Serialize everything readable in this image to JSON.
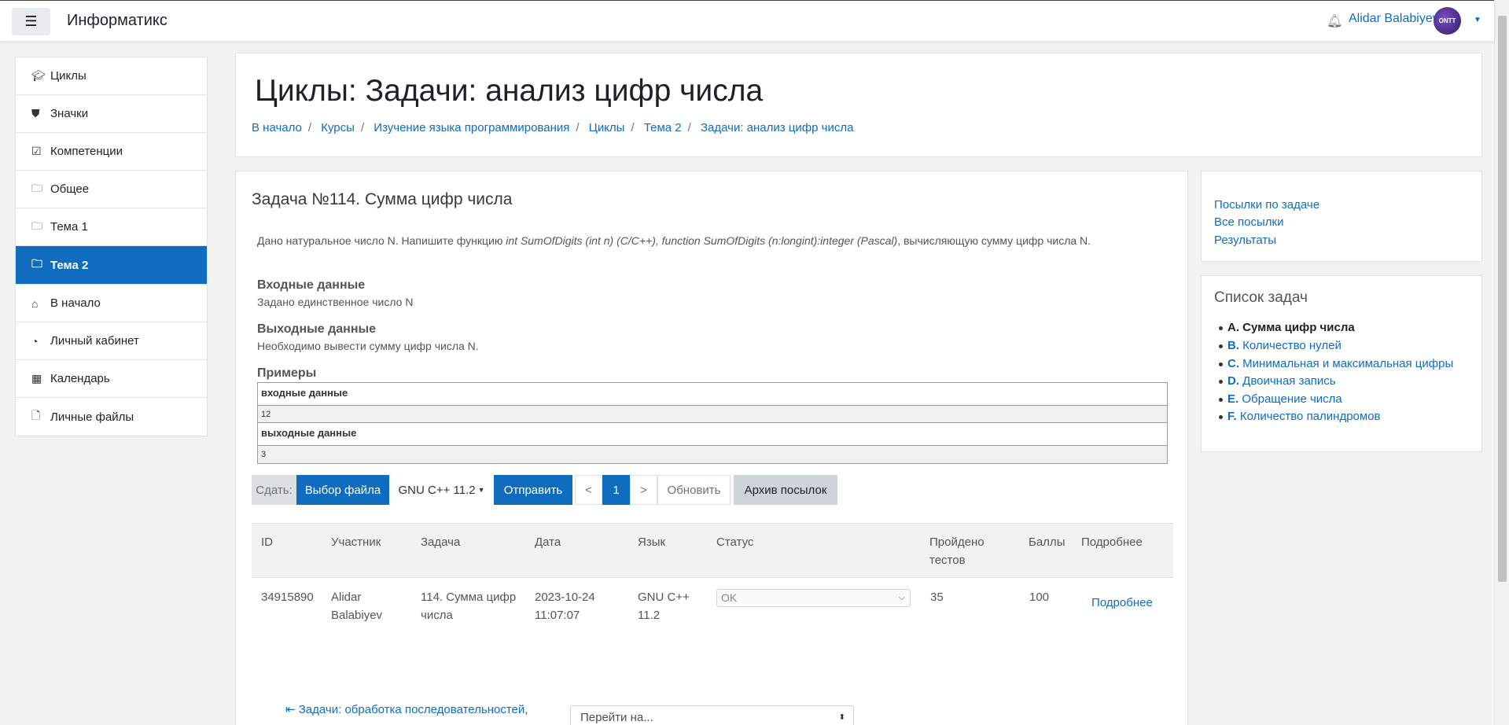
{
  "header": {
    "brand": "Информатикс",
    "user_name": "Alidar Balabiyev",
    "avatar_text": "ONTT"
  },
  "sidebar": {
    "course_items": [
      {
        "icon": "graduation-cap-icon",
        "glyph": "🎓",
        "label": "Циклы"
      },
      {
        "icon": "shield-icon",
        "glyph": "⛊",
        "label": "Значки"
      },
      {
        "icon": "check-square-icon",
        "glyph": "☑",
        "label": "Компетенции"
      },
      {
        "icon": "folder-icon",
        "glyph": "🗀",
        "label": "Общее"
      },
      {
        "icon": "folder-icon",
        "glyph": "🗀",
        "label": "Тема 1"
      },
      {
        "icon": "folder-icon",
        "glyph": "🗀",
        "label": "Тема 2",
        "active": true
      }
    ],
    "site_items": [
      {
        "icon": "home-icon",
        "glyph": "⌂",
        "label": "В начало"
      },
      {
        "icon": "dashboard-icon",
        "glyph": "◔",
        "label": "Личный кабинет"
      },
      {
        "icon": "calendar-icon",
        "glyph": "▦",
        "label": "Календарь"
      },
      {
        "icon": "file-icon",
        "glyph": "🗋",
        "label": "Личные файлы"
      }
    ]
  },
  "page": {
    "title": "Циклы: Задачи: анализ цифр числа",
    "breadcrumbs": [
      "В начало",
      "Курсы",
      "Изучение языка программирования",
      "Циклы",
      "Тема 2",
      "Задачи: анализ цифр числа"
    ]
  },
  "problem": {
    "heading": "Задача №114. Сумма цифр числа",
    "desc_pre": "Дано натуральное число N. Напишите функцию ",
    "desc_code1": "int SumOfDigits (int n) (C/C++), function SumOfDigits (n:longint):integer (Pascal)",
    "desc_post": ", вычисляющую сумму цифр числа N.",
    "input_h": "Входные данные",
    "input_t": "Задано единственное число N",
    "output_h": "Выходные данные",
    "output_t": "Необходимо вывести  сумму цифр числа N.",
    "examples_h": "Примеры",
    "ex_in_label": "входные данные",
    "ex_in": "12",
    "ex_out_label": "выходные данные",
    "ex_out": "3"
  },
  "submit": {
    "label": "Сдать:",
    "choose_file": "Выбор файла",
    "language": "GNU C++ 11.2",
    "send": "Отправить",
    "prev": "<",
    "page": "1",
    "next": ">",
    "refresh": "Обновить",
    "archive": "Архив посылок"
  },
  "table": {
    "headers": [
      "ID",
      "Участник",
      "Задача",
      "Дата",
      "Язык",
      "Статус",
      "Пройдено тестов",
      "Баллы",
      "Подробнее"
    ],
    "row": {
      "id": "34915890",
      "participant": "Alidar Balabiyev",
      "task": "114. Сумма цифр числа",
      "date": "2023-10-24 11:07:07",
      "lang": "GNU C++ 11.2",
      "status": "OK",
      "tests": "35",
      "score": "100",
      "details": "Подробнее"
    }
  },
  "footer_nav": {
    "prev_link": "Задачи: обработка последовательностей,",
    "goto_placeholder": "Перейти на..."
  },
  "right": {
    "links": [
      "Посылки по задаче",
      "Все посылки",
      "Результаты"
    ],
    "tasks_heading": "Список задач",
    "tasks": [
      {
        "letter": "A.",
        "name": "Сумма цифр числа",
        "current": true
      },
      {
        "letter": "B.",
        "name": "Количество нулей"
      },
      {
        "letter": "C.",
        "name": "Минимальная и максимальная цифры"
      },
      {
        "letter": "D.",
        "name": "Двоичная запись"
      },
      {
        "letter": "E.",
        "name": "Обращение числа"
      },
      {
        "letter": "F.",
        "name": "Количество палиндромов"
      }
    ]
  },
  "colors": {
    "accent": "#0f6cbf",
    "page_bg": "#f2f2f2"
  }
}
